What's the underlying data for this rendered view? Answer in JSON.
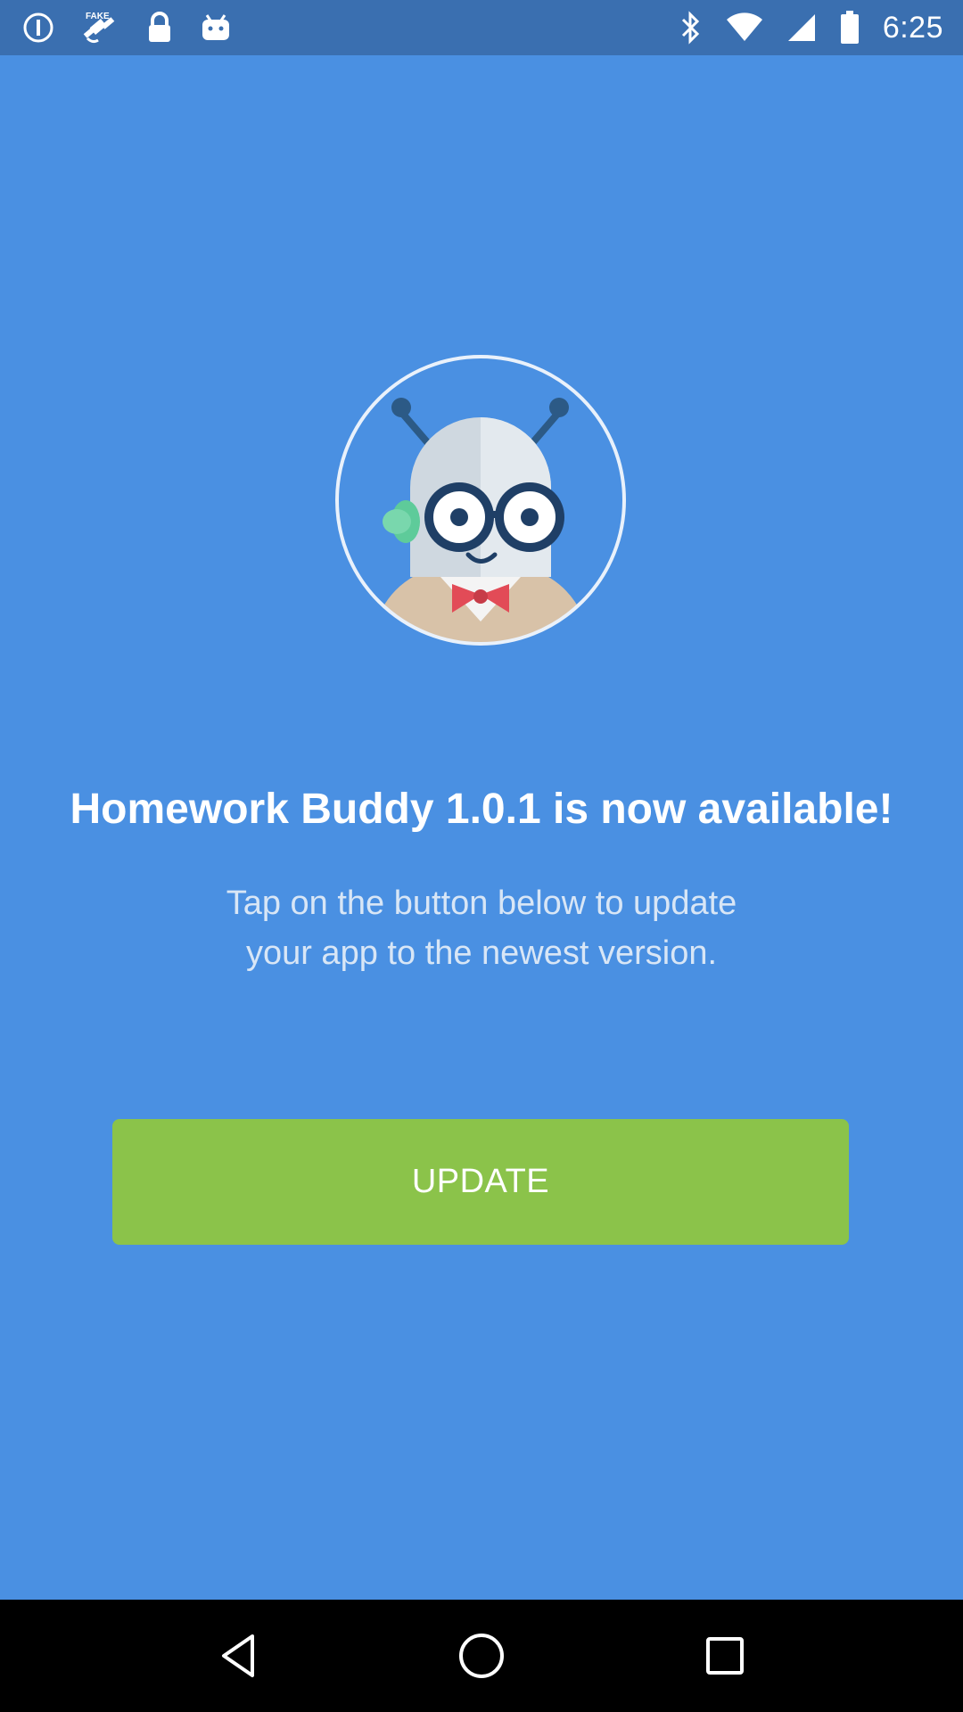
{
  "status_bar": {
    "time": "6:25",
    "left_icons": [
      "alert-circle-icon",
      "fake-gps-icon",
      "lock-icon",
      "android-icon"
    ],
    "right_icons": [
      "bluetooth-icon",
      "wifi-icon",
      "signal-icon",
      "battery-icon"
    ]
  },
  "main": {
    "headline": "Homework Buddy 1.0.1 is now available!",
    "subtext_line1": "Tap on the button below to update",
    "subtext_line2": "your app to the newest version.",
    "update_button_label": "UPDATE"
  },
  "nav_bar": {
    "icons": [
      "back-icon",
      "home-icon",
      "recents-icon"
    ]
  },
  "colors": {
    "background": "#4a90e2",
    "status_bar": "#3a6fb0",
    "button": "#8bc34a",
    "nav_bar": "#000000"
  }
}
